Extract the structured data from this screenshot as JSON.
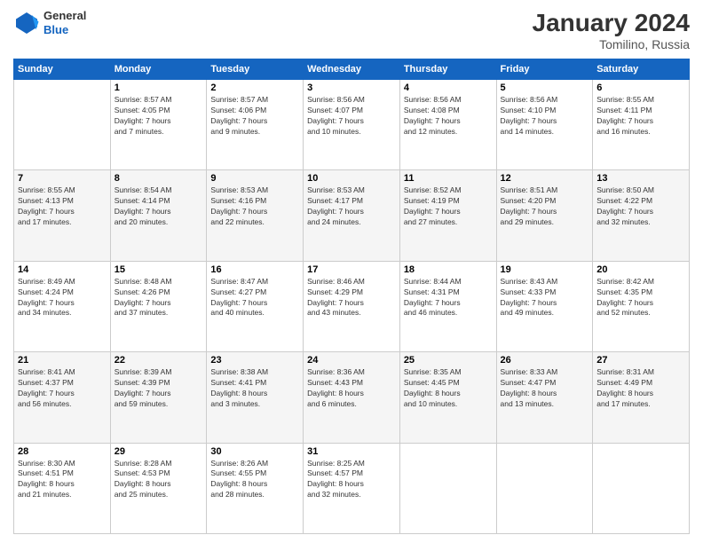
{
  "header": {
    "logo": {
      "general": "General",
      "blue": "Blue"
    },
    "title": "January 2024",
    "location": "Tomilino, Russia"
  },
  "calendar": {
    "days_of_week": [
      "Sunday",
      "Monday",
      "Tuesday",
      "Wednesday",
      "Thursday",
      "Friday",
      "Saturday"
    ],
    "weeks": [
      [
        {
          "day": "",
          "info": ""
        },
        {
          "day": "1",
          "info": "Sunrise: 8:57 AM\nSunset: 4:05 PM\nDaylight: 7 hours\nand 7 minutes."
        },
        {
          "day": "2",
          "info": "Sunrise: 8:57 AM\nSunset: 4:06 PM\nDaylight: 7 hours\nand 9 minutes."
        },
        {
          "day": "3",
          "info": "Sunrise: 8:56 AM\nSunset: 4:07 PM\nDaylight: 7 hours\nand 10 minutes."
        },
        {
          "day": "4",
          "info": "Sunrise: 8:56 AM\nSunset: 4:08 PM\nDaylight: 7 hours\nand 12 minutes."
        },
        {
          "day": "5",
          "info": "Sunrise: 8:56 AM\nSunset: 4:10 PM\nDaylight: 7 hours\nand 14 minutes."
        },
        {
          "day": "6",
          "info": "Sunrise: 8:55 AM\nSunset: 4:11 PM\nDaylight: 7 hours\nand 16 minutes."
        }
      ],
      [
        {
          "day": "7",
          "info": "Sunrise: 8:55 AM\nSunset: 4:13 PM\nDaylight: 7 hours\nand 17 minutes."
        },
        {
          "day": "8",
          "info": "Sunrise: 8:54 AM\nSunset: 4:14 PM\nDaylight: 7 hours\nand 20 minutes."
        },
        {
          "day": "9",
          "info": "Sunrise: 8:53 AM\nSunset: 4:16 PM\nDaylight: 7 hours\nand 22 minutes."
        },
        {
          "day": "10",
          "info": "Sunrise: 8:53 AM\nSunset: 4:17 PM\nDaylight: 7 hours\nand 24 minutes."
        },
        {
          "day": "11",
          "info": "Sunrise: 8:52 AM\nSunset: 4:19 PM\nDaylight: 7 hours\nand 27 minutes."
        },
        {
          "day": "12",
          "info": "Sunrise: 8:51 AM\nSunset: 4:20 PM\nDaylight: 7 hours\nand 29 minutes."
        },
        {
          "day": "13",
          "info": "Sunrise: 8:50 AM\nSunset: 4:22 PM\nDaylight: 7 hours\nand 32 minutes."
        }
      ],
      [
        {
          "day": "14",
          "info": "Sunrise: 8:49 AM\nSunset: 4:24 PM\nDaylight: 7 hours\nand 34 minutes."
        },
        {
          "day": "15",
          "info": "Sunrise: 8:48 AM\nSunset: 4:26 PM\nDaylight: 7 hours\nand 37 minutes."
        },
        {
          "day": "16",
          "info": "Sunrise: 8:47 AM\nSunset: 4:27 PM\nDaylight: 7 hours\nand 40 minutes."
        },
        {
          "day": "17",
          "info": "Sunrise: 8:46 AM\nSunset: 4:29 PM\nDaylight: 7 hours\nand 43 minutes."
        },
        {
          "day": "18",
          "info": "Sunrise: 8:44 AM\nSunset: 4:31 PM\nDaylight: 7 hours\nand 46 minutes."
        },
        {
          "day": "19",
          "info": "Sunrise: 8:43 AM\nSunset: 4:33 PM\nDaylight: 7 hours\nand 49 minutes."
        },
        {
          "day": "20",
          "info": "Sunrise: 8:42 AM\nSunset: 4:35 PM\nDaylight: 7 hours\nand 52 minutes."
        }
      ],
      [
        {
          "day": "21",
          "info": "Sunrise: 8:41 AM\nSunset: 4:37 PM\nDaylight: 7 hours\nand 56 minutes."
        },
        {
          "day": "22",
          "info": "Sunrise: 8:39 AM\nSunset: 4:39 PM\nDaylight: 7 hours\nand 59 minutes."
        },
        {
          "day": "23",
          "info": "Sunrise: 8:38 AM\nSunset: 4:41 PM\nDaylight: 8 hours\nand 3 minutes."
        },
        {
          "day": "24",
          "info": "Sunrise: 8:36 AM\nSunset: 4:43 PM\nDaylight: 8 hours\nand 6 minutes."
        },
        {
          "day": "25",
          "info": "Sunrise: 8:35 AM\nSunset: 4:45 PM\nDaylight: 8 hours\nand 10 minutes."
        },
        {
          "day": "26",
          "info": "Sunrise: 8:33 AM\nSunset: 4:47 PM\nDaylight: 8 hours\nand 13 minutes."
        },
        {
          "day": "27",
          "info": "Sunrise: 8:31 AM\nSunset: 4:49 PM\nDaylight: 8 hours\nand 17 minutes."
        }
      ],
      [
        {
          "day": "28",
          "info": "Sunrise: 8:30 AM\nSunset: 4:51 PM\nDaylight: 8 hours\nand 21 minutes."
        },
        {
          "day": "29",
          "info": "Sunrise: 8:28 AM\nSunset: 4:53 PM\nDaylight: 8 hours\nand 25 minutes."
        },
        {
          "day": "30",
          "info": "Sunrise: 8:26 AM\nSunset: 4:55 PM\nDaylight: 8 hours\nand 28 minutes."
        },
        {
          "day": "31",
          "info": "Sunrise: 8:25 AM\nSunset: 4:57 PM\nDaylight: 8 hours\nand 32 minutes."
        },
        {
          "day": "",
          "info": ""
        },
        {
          "day": "",
          "info": ""
        },
        {
          "day": "",
          "info": ""
        }
      ]
    ]
  }
}
